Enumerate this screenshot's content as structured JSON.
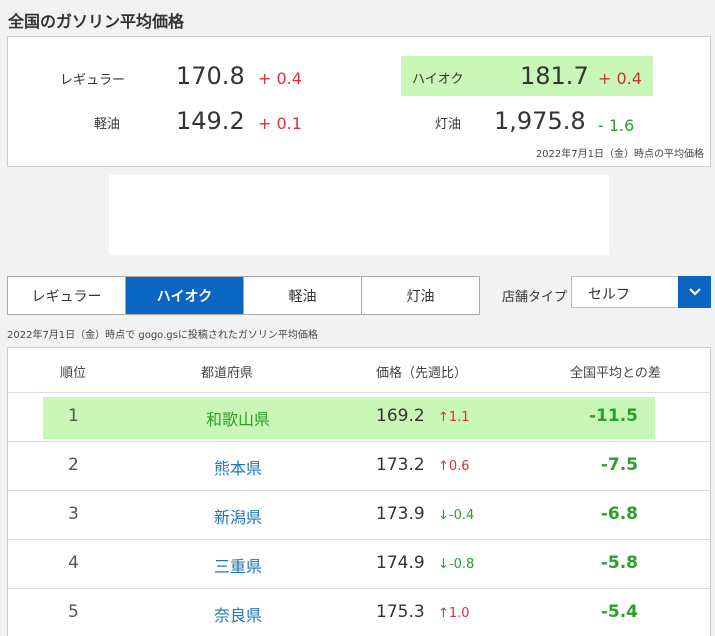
{
  "page_title": "全国のガソリン平均価格",
  "summary": {
    "regular": {
      "label": "レギュラー",
      "price": "170.8",
      "diff": "+ 0.4"
    },
    "highoctane": {
      "label": "ハイオク",
      "price": "181.7",
      "diff": "+ 0.4"
    },
    "diesel": {
      "label": "軽油",
      "price": "149.2",
      "diff": "+ 0.1"
    },
    "kerosene": {
      "label": "灯油",
      "price": "1,975.8",
      "diff": "- 1.6"
    },
    "note": "2022年7月1日（金）時点の平均価格"
  },
  "tabs": [
    "レギュラー",
    "ハイオク",
    "軽油",
    "灯油"
  ],
  "active_tab": "ハイオク",
  "store_type": {
    "label": "店舗タイプ",
    "value": "セルフ"
  },
  "list_note": "2022年7月1日（金）時点で gogo.gsに投稿されたガソリン平均価格",
  "table": {
    "headers": [
      "順位",
      "都道府県",
      "価格（先週比）",
      "全国平均との差"
    ],
    "rows": [
      {
        "rank": "1",
        "prefecture": "和歌山県",
        "price": "169.2",
        "change": "↑1.1",
        "dir": "up",
        "gap": "-11.5"
      },
      {
        "rank": "2",
        "prefecture": "熊本県",
        "price": "173.2",
        "change": "↑0.6",
        "dir": "up",
        "gap": "-7.5"
      },
      {
        "rank": "3",
        "prefecture": "新潟県",
        "price": "173.9",
        "change": "↓-0.4",
        "dir": "down",
        "gap": "-6.8"
      },
      {
        "rank": "4",
        "prefecture": "三重県",
        "price": "174.9",
        "change": "↓-0.8",
        "dir": "down",
        "gap": "-5.8"
      },
      {
        "rank": "5",
        "prefecture": "奈良県",
        "price": "175.3",
        "change": "↑1.0",
        "dir": "up",
        "gap": "-5.4"
      }
    ]
  },
  "colors": {
    "accent": "#0a66c2",
    "highlight": "#c9f7b7",
    "up": "#d9303c",
    "down": "#2aa02a"
  },
  "icons": {
    "select_arrow": "chevron-down-icon"
  }
}
